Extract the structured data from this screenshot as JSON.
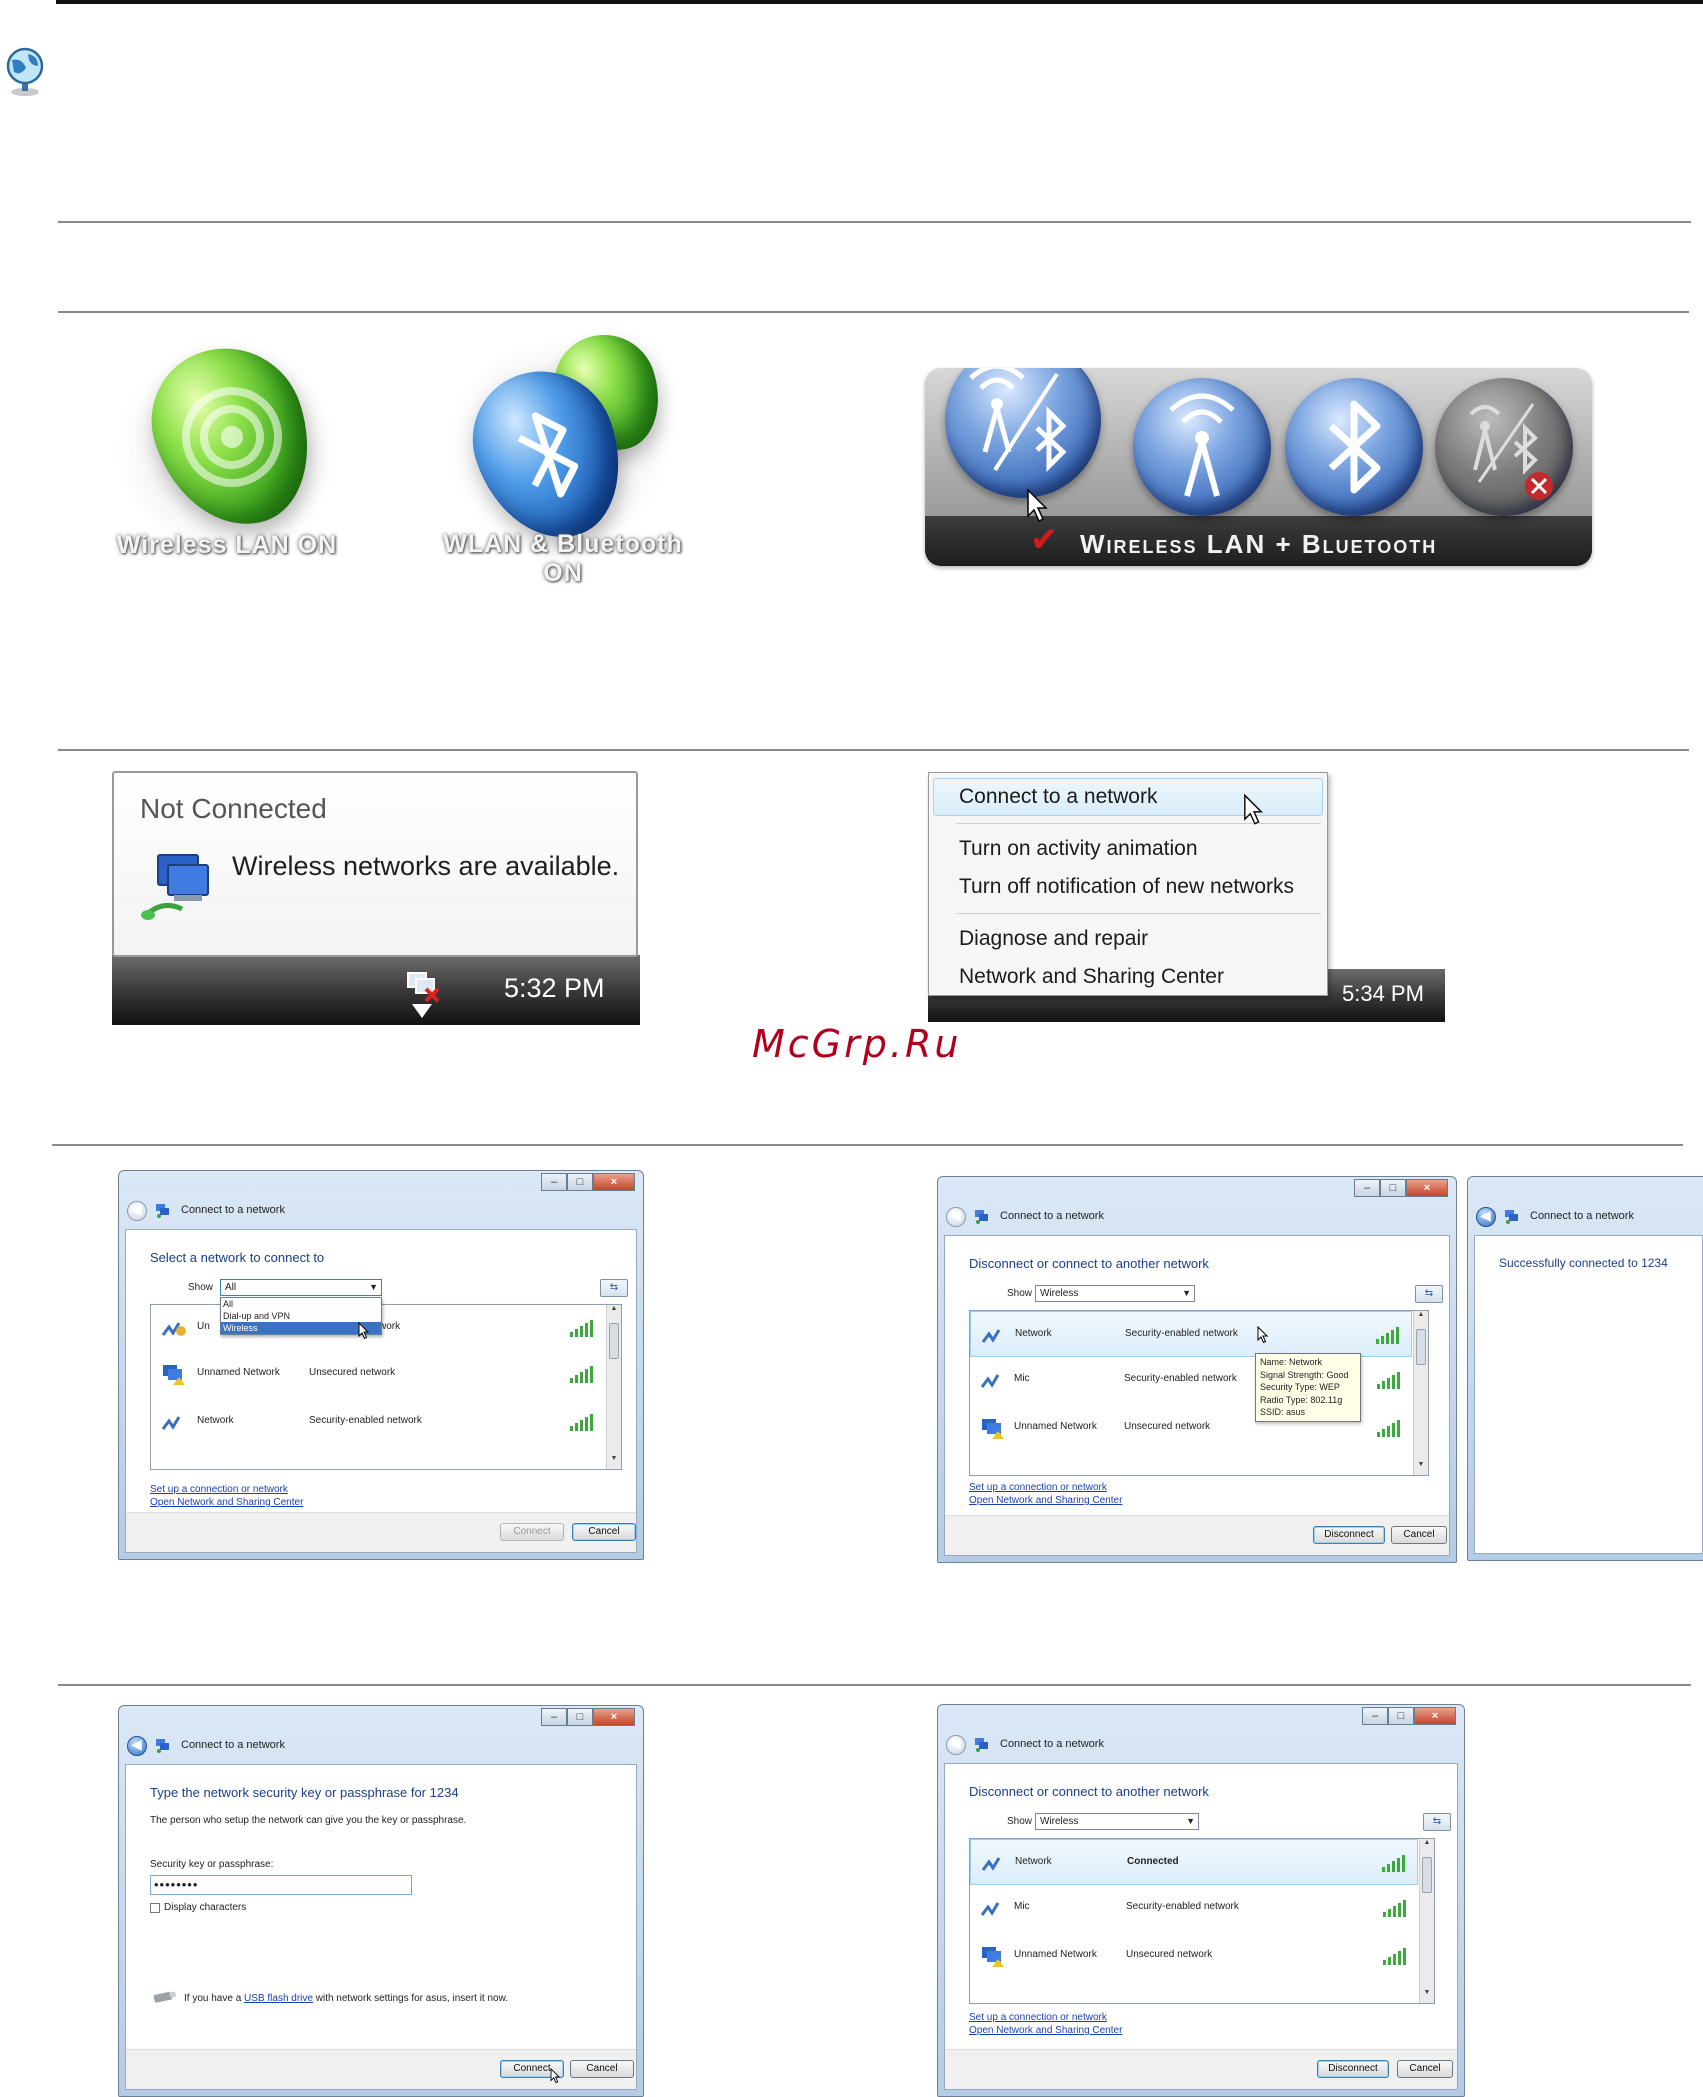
{
  "osd": {
    "wlan_on_label": "Wireless LAN ON",
    "wlan_bt_on_label": "WLAN & Bluetooth ON",
    "bar_label": "Wireless LAN + Bluetooth"
  },
  "tray": {
    "balloon_title": "Not Connected",
    "balloon_message": "Wireless networks are available.",
    "time_left": "5:32 PM",
    "time_right": "5:34 PM",
    "menu": {
      "items": [
        "Connect to a network",
        "Turn on activity animation",
        "Turn off notification of new networks",
        "Diagnose and repair",
        "Network and Sharing Center"
      ]
    }
  },
  "watermark": "McGrp.Ru",
  "dialog_common": {
    "window_title": "Connect to a network",
    "show_label": "Show",
    "setup_link": "Set up a connection or network",
    "sharing_link": "Open Network and Sharing Center",
    "cancel": "Cancel",
    "connect": "Connect",
    "disconnect": "Disconnect"
  },
  "dialog1": {
    "heading": "Select a network to connect to",
    "show_value": "All",
    "dropdown_options": [
      "All",
      "Dial-up and VPN",
      "Wireless"
    ],
    "rows": [
      {
        "name": "Un",
        "security": "work"
      },
      {
        "name": "Unnamed Network",
        "security": "Unsecured network"
      },
      {
        "name": "Network",
        "security": "Security-enabled network"
      }
    ]
  },
  "dialog2": {
    "heading": "Disconnect or connect to another network",
    "show_value": "Wireless",
    "rows": [
      {
        "name": "Network",
        "security": "Security-enabled network"
      },
      {
        "name": "Mic",
        "security": "Security-enabled network"
      },
      {
        "name": "Unnamed Network",
        "security": "Unsecured network"
      }
    ],
    "tooltip": [
      "Name: Network",
      "Signal Strength: Good",
      "Security Type: WEP",
      "Radio Type: 802.11g",
      "SSID: asus"
    ]
  },
  "dialog3": {
    "heading": "Successfully connected to 1234"
  },
  "dialog4": {
    "heading": "Type the network security key or passphrase for 1234",
    "subtext": "The person who setup the network can give you the key or passphrase.",
    "key_label": "Security key or passphrase:",
    "key_value": "••••••••",
    "display_chars": "Display characters",
    "usb_prefix": "If you have a",
    "usb_link": "USB flash drive",
    "usb_suffix": "with network settings for asus, insert it now."
  },
  "dialog5": {
    "heading": "Disconnect or connect to another network",
    "show_value": "Wireless",
    "rows": [
      {
        "name": "Network",
        "security": "Connected"
      },
      {
        "name": "Mic",
        "security": "Security-enabled network"
      },
      {
        "name": "Unnamed Network",
        "security": "Unsecured network"
      }
    ]
  },
  "colors": {
    "heading_blue": "#1b3d8a",
    "link_blue": "#1a3fb1",
    "watermark_red": "#b0001c"
  }
}
